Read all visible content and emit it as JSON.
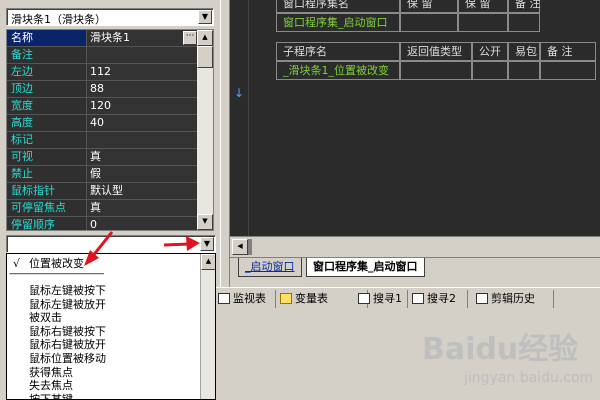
{
  "object_selector": {
    "value": "滑块条1（滑块条）"
  },
  "properties": [
    {
      "name": "名称",
      "value": "滑块条1",
      "selected": true
    },
    {
      "name": "备注",
      "value": ""
    },
    {
      "name": "左边",
      "value": "112"
    },
    {
      "name": "顶边",
      "value": "88"
    },
    {
      "name": "宽度",
      "value": "120"
    },
    {
      "name": "高度",
      "value": "40"
    },
    {
      "name": "标记",
      "value": ""
    },
    {
      "name": "可视",
      "value": "真"
    },
    {
      "name": "禁止",
      "value": "假"
    },
    {
      "name": "鼠标指针",
      "value": "默认型"
    },
    {
      "name": "可停留焦点",
      "value": "真"
    },
    {
      "name": "停留顺序",
      "value": "0"
    }
  ],
  "ellipsis_label": "···",
  "event_selector": {
    "value": ""
  },
  "event_list": {
    "checked_item": "位置被改变",
    "checkmark": "√",
    "separator": "------------------------------------------",
    "items": [
      "鼠标左键被按下",
      "鼠标左键被放开",
      "被双击",
      "鼠标右键被按下",
      "鼠标右键被放开",
      "鼠标位置被移动",
      "获得焦点",
      "失去焦点",
      "按下某键"
    ]
  },
  "editor": {
    "table1": {
      "headers": [
        "窗口程序集名",
        "保 留",
        "保 留",
        "备 注"
      ],
      "row": [
        "窗口程序集_启动窗口",
        "",
        "",
        ""
      ]
    },
    "table2": {
      "headers": [
        "子程序名",
        "返回值类型",
        "公开",
        "易包",
        "备 注"
      ],
      "row": [
        "_滑块条1_位置被改变",
        "",
        "",
        "",
        ""
      ]
    },
    "arrow_glyph": "↓"
  },
  "doc_tabs": [
    "_启动窗口",
    "窗口程序集_启动窗口"
  ],
  "bottom_tabs": [
    "监视表",
    "变量表",
    "搜寻1",
    "搜寻2",
    "剪辑历史"
  ],
  "watermark": {
    "brand": "Baidu经验",
    "url": "jingyan.baidu.com"
  },
  "colors": {
    "editor_bg": "#2b2b2b",
    "property_name": "#2adcd2",
    "code_green": "#7fd03a",
    "annotation_red": "#e0141e"
  }
}
